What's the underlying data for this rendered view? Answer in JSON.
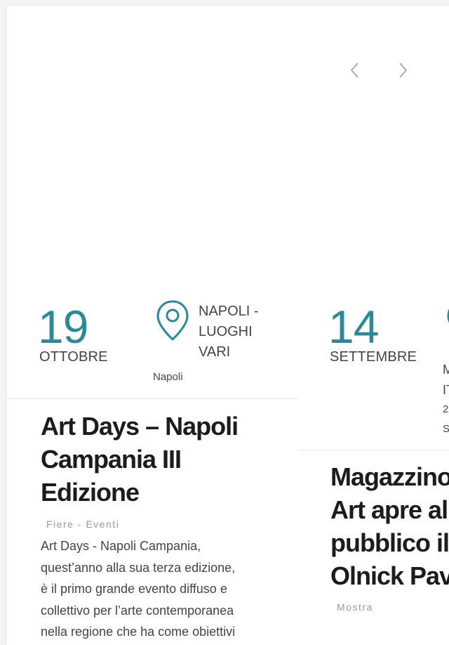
{
  "carousel": {
    "prev_icon": "chevron-left-icon",
    "next_icon": "chevron-right-icon"
  },
  "events": [
    {
      "day": "19",
      "month": "OTTOBRE",
      "location": [
        "NAPOLI -",
        "LUOGHI",
        "VARI"
      ],
      "city": "Napoli",
      "title": [
        "Art Days – Napoli",
        "Campania III",
        "Edizione"
      ],
      "category": "Fiere - Eventi",
      "description": [
        "Art Days - Napoli Campania,",
        "quest’anno alla sua terza edizione,",
        "è il primo grande evento diffuso e",
        "collettivo per l’arte contemporanea",
        "nella regione che ha come obiettivi"
      ]
    },
    {
      "day": "14",
      "month": "SETTEMBRE",
      "location_partial": [
        "M",
        "IT",
        "2",
        "S"
      ],
      "title": [
        "Magazzino",
        "Art apre al",
        "pubblico il",
        "Olnick Pav"
      ],
      "category": "Mostra"
    }
  ],
  "colors": {
    "accent": "#2a8a9a",
    "text": "#444444",
    "heading": "#1c1c1c"
  }
}
